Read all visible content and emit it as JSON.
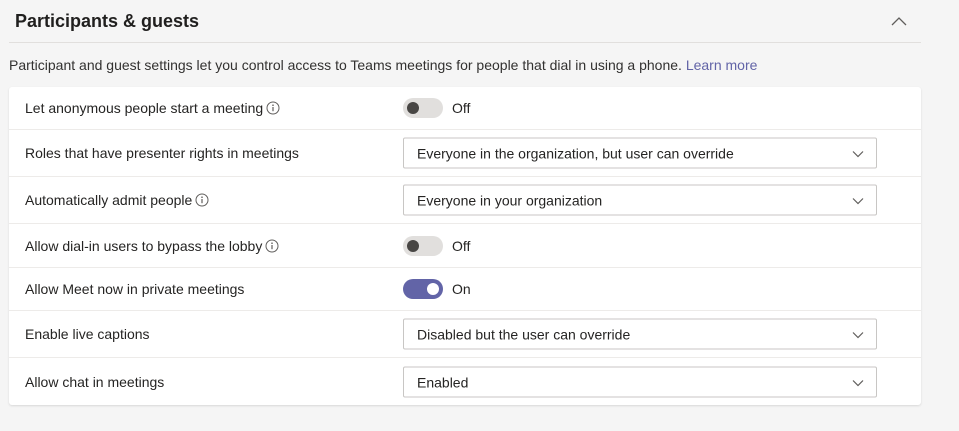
{
  "section": {
    "title": "Participants & guests",
    "description": "Participant and guest settings let you control access to Teams meetings for people that dial in using a phone.",
    "learn_more": "Learn more"
  },
  "settings": [
    {
      "label": "Let anonymous people start a meeting",
      "info": true,
      "control": "toggle",
      "state": "off",
      "value": "Off"
    },
    {
      "label": "Roles that have presenter rights in meetings",
      "info": false,
      "control": "select",
      "value": "Everyone in the organization, but user can override"
    },
    {
      "label": "Automatically admit people",
      "info": true,
      "control": "select",
      "value": "Everyone in your organization"
    },
    {
      "label": "Allow dial-in users to bypass the lobby",
      "info": true,
      "control": "toggle",
      "state": "off",
      "value": "Off"
    },
    {
      "label": "Allow Meet now in private meetings",
      "info": false,
      "control": "toggle",
      "state": "on",
      "value": "On"
    },
    {
      "label": "Enable live captions",
      "info": false,
      "control": "select",
      "value": "Disabled but the user can override"
    },
    {
      "label": "Allow chat in meetings",
      "info": false,
      "control": "select",
      "value": "Enabled"
    }
  ],
  "colors": {
    "accent": "#6264a7",
    "toggle_off": "#e1dfdd",
    "background": "#f5f5f5"
  }
}
